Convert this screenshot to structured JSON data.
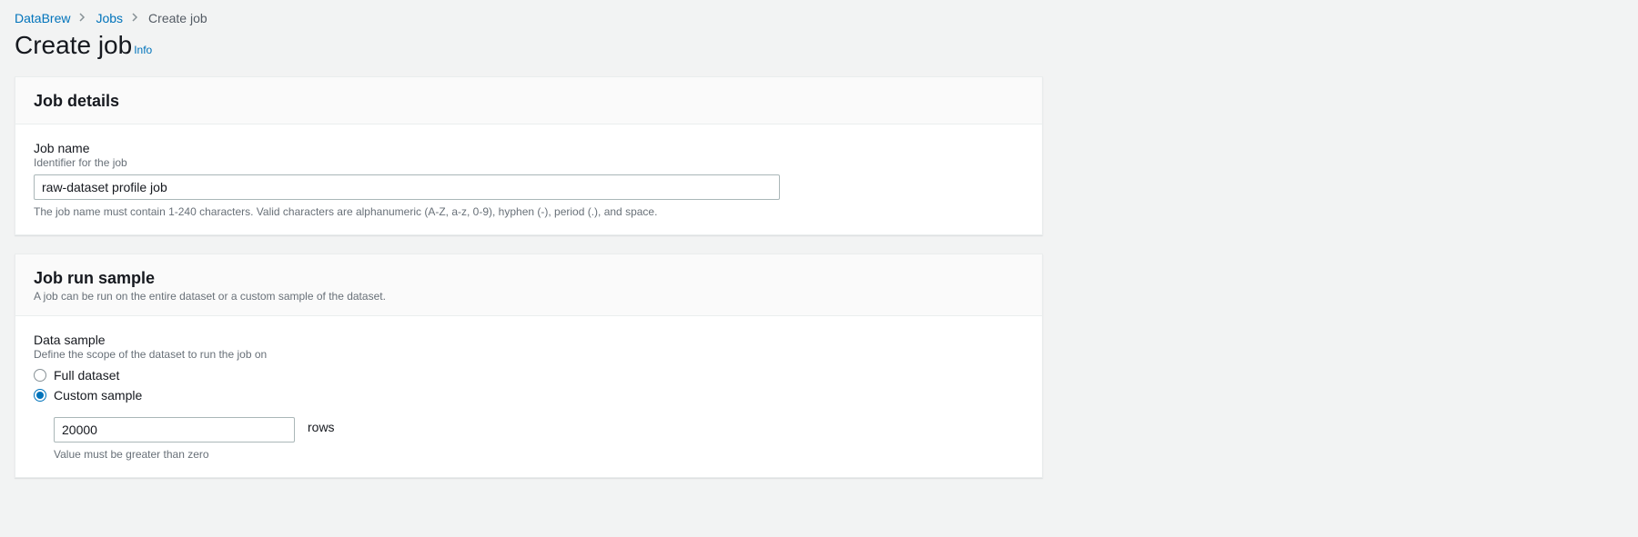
{
  "breadcrumb": {
    "root": "DataBrew",
    "mid": "Jobs",
    "current": "Create job"
  },
  "page": {
    "title": "Create job",
    "info": "Info"
  },
  "job_details": {
    "heading": "Job details",
    "name_label": "Job name",
    "name_help": "Identifier for the job",
    "name_value": "raw-dataset profile job",
    "name_constraint": "The job name must contain 1-240 characters. Valid characters are alphanumeric (A-Z, a-z, 0-9), hyphen (-), period (.), and space."
  },
  "job_run_sample": {
    "heading": "Job run sample",
    "sub": "A job can be run on the entire dataset or a custom sample of the dataset.",
    "data_sample_label": "Data sample",
    "data_sample_help": "Define the scope of the dataset to run the job on",
    "option_full": "Full dataset",
    "option_custom": "Custom sample",
    "sample_value": "20000",
    "rows_label": "rows",
    "sample_constraint": "Value must be greater than zero"
  }
}
